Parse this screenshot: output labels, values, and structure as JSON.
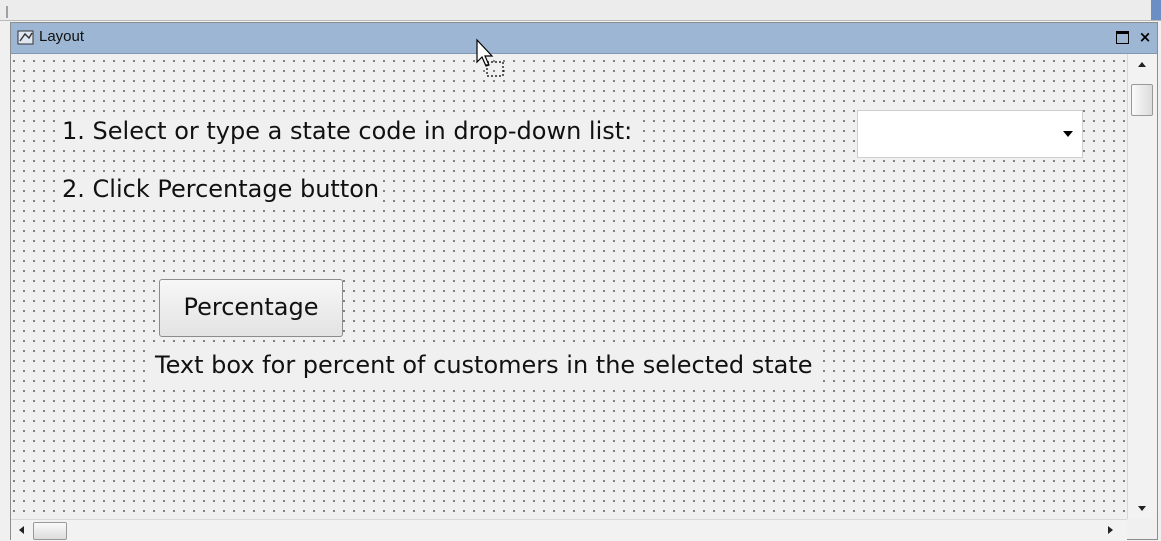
{
  "window": {
    "title": "Layout",
    "icon": "layout-icon",
    "buttons": {
      "maximize": "maximize-icon",
      "close": "×"
    }
  },
  "form": {
    "step1_label": "1. Select or type a state code in drop-down list:",
    "state_dropdown": {
      "value": "",
      "icon": "chevron-down-icon"
    },
    "step2_label": "2. Click Percentage button",
    "percentage_button_label": "Percentage",
    "result_hint": "Text box for percent of customers in the selected state"
  },
  "colors": {
    "titlebar": "#9db6d3",
    "canvas_background": "#f0f0f0",
    "grid_dots": "#6a6a6a"
  }
}
